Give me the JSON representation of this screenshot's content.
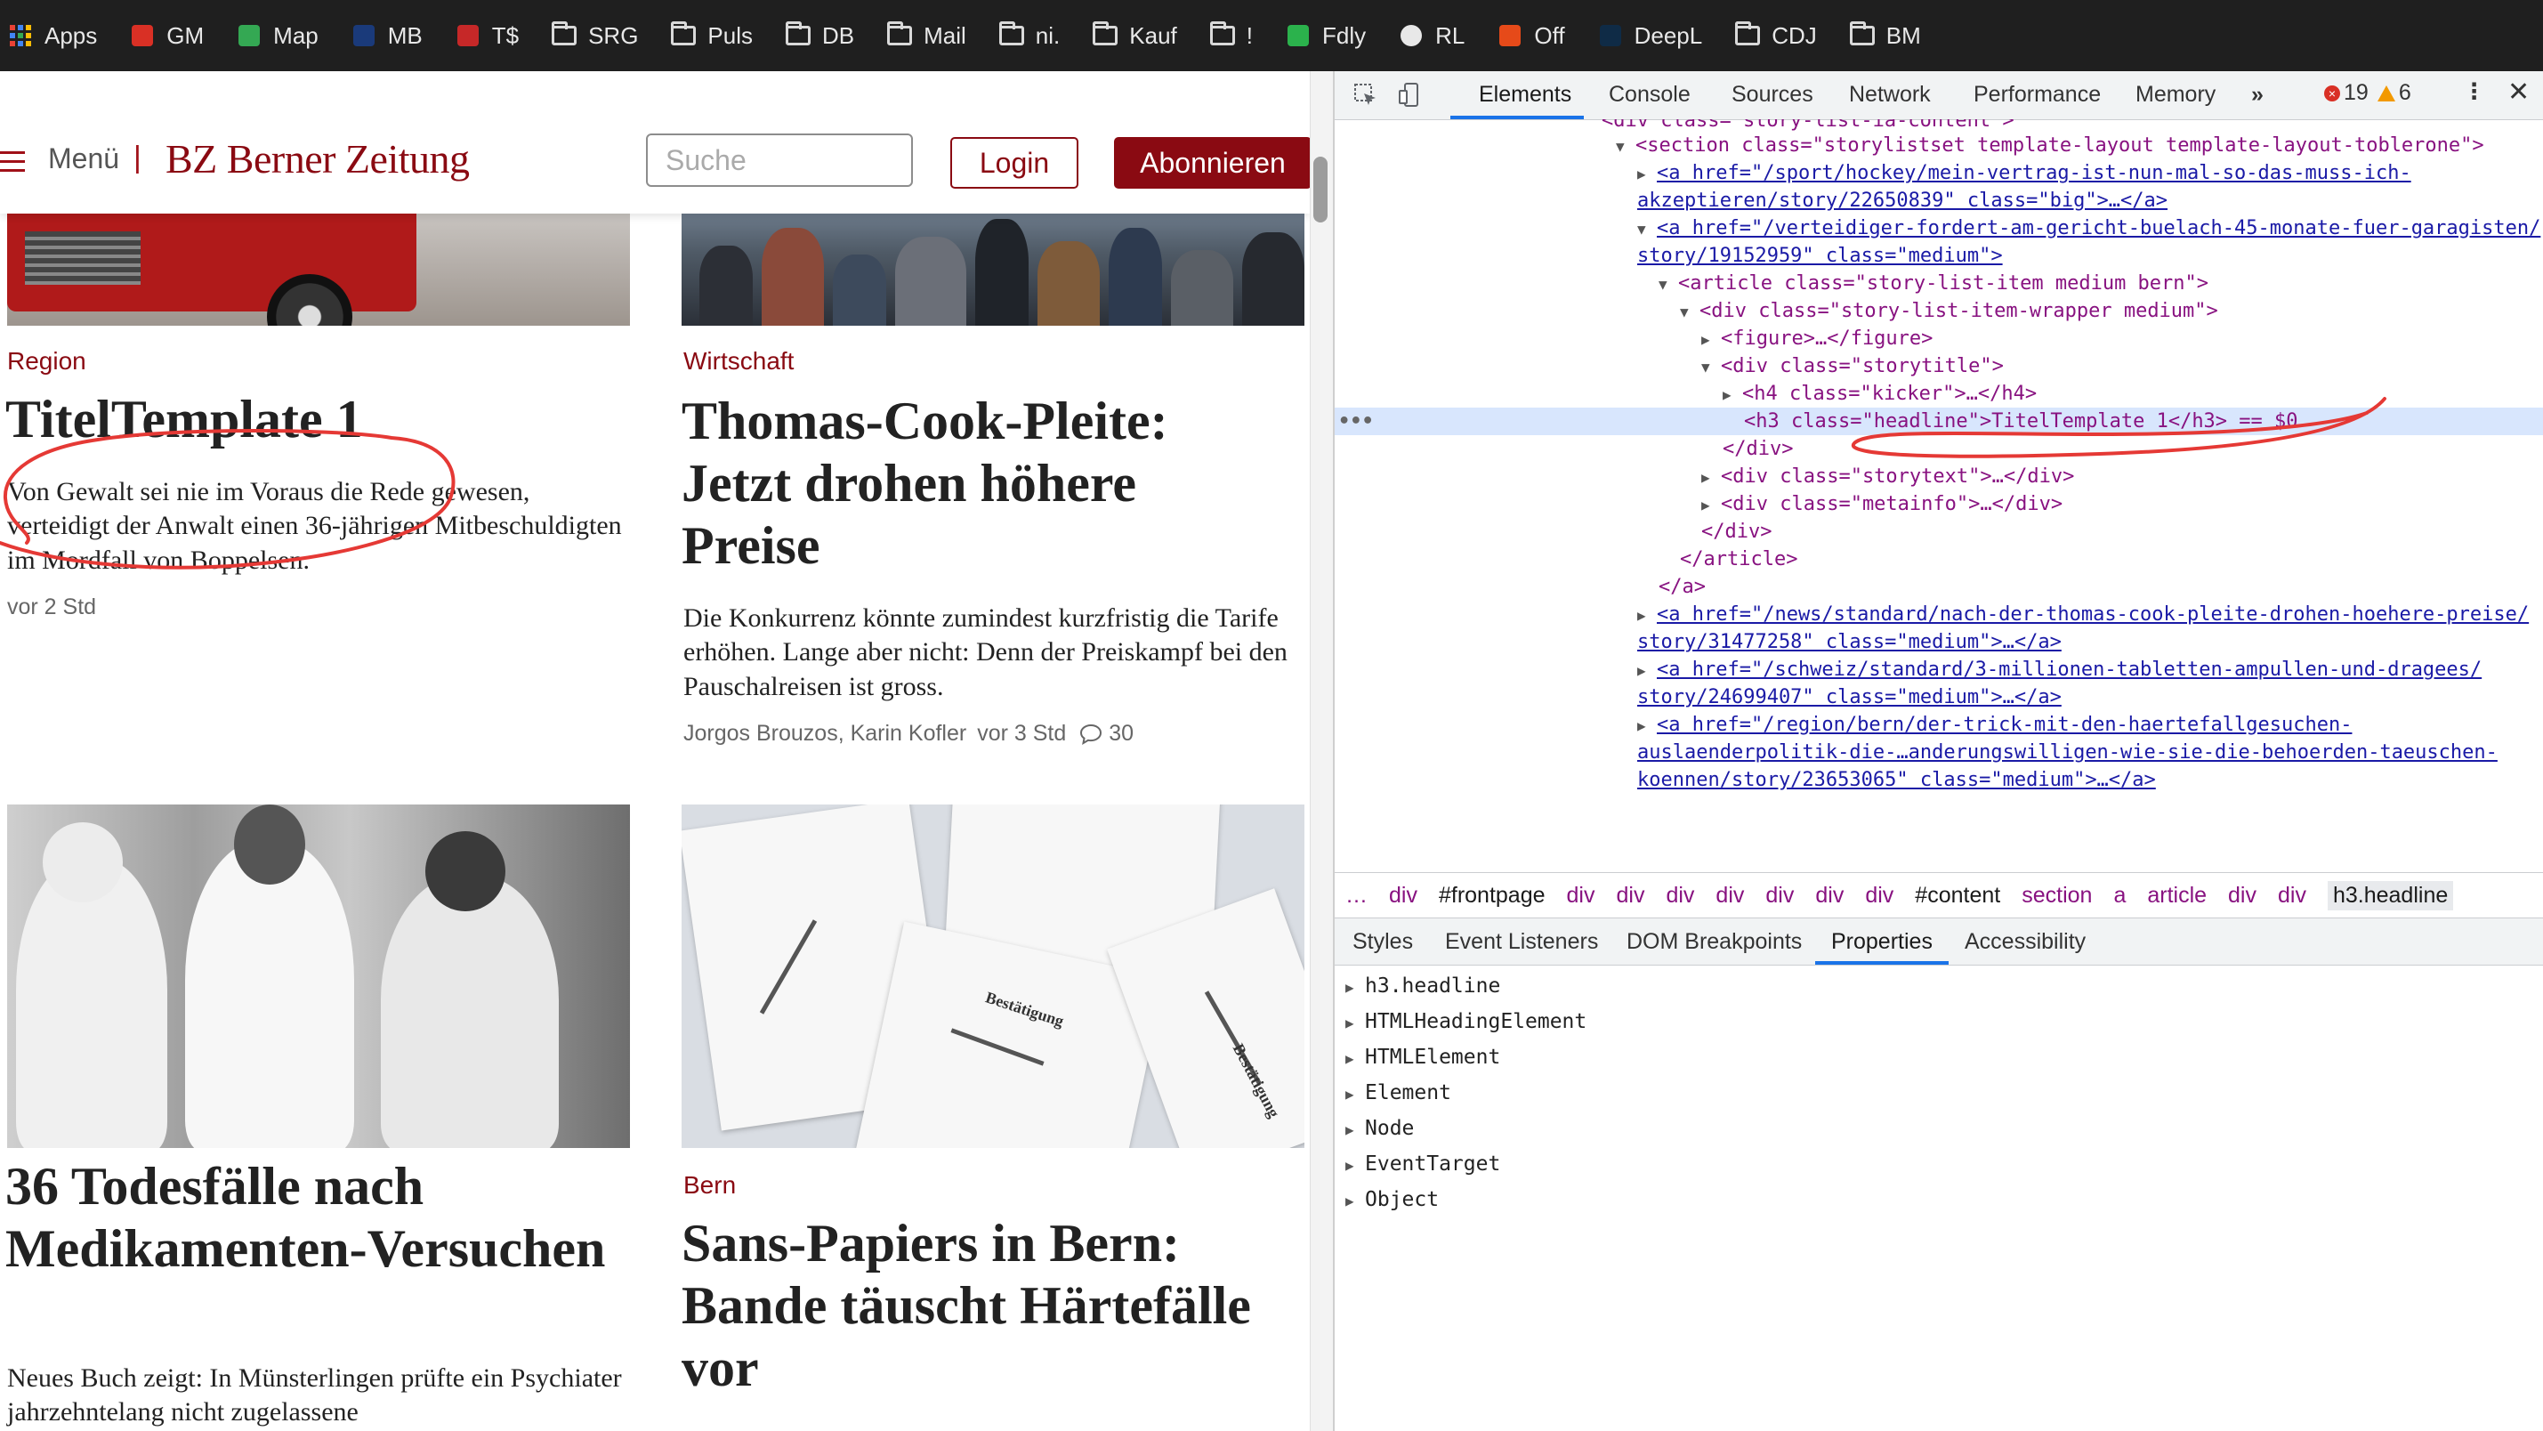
{
  "bookmarks": [
    {
      "label": "Apps",
      "icon": "apps-grid-icon"
    },
    {
      "label": "GM",
      "icon": "gmail-icon"
    },
    {
      "label": "Map",
      "icon": "maps-icon"
    },
    {
      "label": "MB",
      "icon": "mb-icon"
    },
    {
      "label": "T$",
      "icon": "tp-icon"
    },
    {
      "label": "SRG",
      "icon": "folder-icon"
    },
    {
      "label": "Puls",
      "icon": "folder-icon"
    },
    {
      "label": "DB",
      "icon": "folder-icon"
    },
    {
      "label": "Mail",
      "icon": "folder-icon"
    },
    {
      "label": "ni.",
      "icon": "folder-icon"
    },
    {
      "label": "Kauf",
      "icon": "folder-icon"
    },
    {
      "label": "!",
      "icon": "folder-icon"
    },
    {
      "label": "Fdly",
      "icon": "feedly-icon"
    },
    {
      "label": "RL",
      "icon": "globe-icon"
    },
    {
      "label": "Off",
      "icon": "office-icon"
    },
    {
      "label": "DeepL",
      "icon": "deepl-icon"
    },
    {
      "label": "CDJ",
      "icon": "folder-icon"
    },
    {
      "label": "BM",
      "icon": "folder-icon"
    }
  ],
  "site": {
    "menu_label": "Menü",
    "logo_text": "BZ Berner Zeitung",
    "search_placeholder": "Suche",
    "login_label": "Login",
    "subscribe_label": "Abonnieren",
    "brand_color": "#8a0a12"
  },
  "articles": [
    {
      "kicker": "Region",
      "headline": "TitelTemplate 1",
      "lead": "Von Gewalt sei nie im Voraus die Rede gewesen, verteidigt der Anwalt einen 36-jährigen Mitbeschuldigten im Mordfall von Boppelsen.",
      "time": "vor 2 Std"
    },
    {
      "kicker": "Wirtschaft",
      "headline": "Thomas-Cook-Pleite: Jetzt drohen höhere Preise",
      "lead": "Die Konkurrenz könnte zumindest kurzfristig die Tarife erhöhen. Lange aber nicht: Denn der Preiskampf bei den Pauschalreisen ist gross.",
      "authors": "Jorgos Brouzos, Karin Kofler",
      "time": "vor 3 Std",
      "comments": "30"
    },
    {
      "kicker": "",
      "headline": "36 Todesfälle nach Medikamenten-Versuchen",
      "lead": "Neues Buch zeigt: In Münsterlingen prüfte ein Psychiater jahrzehntelang nicht zugelassene"
    },
    {
      "kicker": "Bern",
      "headline": "Sans-Papiers in Bern: Bande täuscht Härtefälle vor",
      "image_text": [
        "Bestätigung",
        "Bestätigung"
      ]
    }
  ],
  "devtools": {
    "tabs": [
      "Elements",
      "Console",
      "Sources",
      "Network",
      "Performance",
      "Memory"
    ],
    "active_tab": "Elements",
    "more_tabs": "»",
    "errors": "19",
    "warnings": "6",
    "dom_lines": [
      {
        "text": "<div class=\"story-list-ia-content\">"
      },
      {
        "text": "<section class=\"storylistset template-layout template-layout-toblerone\">"
      },
      {
        "text": "<a href=\"/sport/hockey/mein-vertrag-ist-nun-mal-so-das-muss-ich-"
      },
      {
        "text": "akzeptieren/story/22650839\" class=\"big\">…</a>"
      },
      {
        "text": "<a href=\"/verteidiger-fordert-am-gericht-buelach-45-monate-fuer-garagisten/"
      },
      {
        "text": "story/19152959\" class=\"medium\">"
      },
      {
        "text": "<article class=\"story-list-item medium bern\">"
      },
      {
        "text": "<div class=\"story-list-item-wrapper medium\">"
      },
      {
        "text": "<figure>…</figure>"
      },
      {
        "text": "<div class=\"storytitle\">"
      },
      {
        "text": "<h4 class=\"kicker\">…</h4>"
      },
      {
        "text": "<h3 class=\"headline\">TitelTemplate 1</h3> == $0"
      },
      {
        "text": "</div>"
      },
      {
        "text": "<div class=\"storytext\">…</div>"
      },
      {
        "text": "<div class=\"metainfo\">…</div>"
      },
      {
        "text": "</div>"
      },
      {
        "text": "</article>"
      },
      {
        "text": "</a>"
      },
      {
        "text": "<a href=\"/news/standard/nach-der-thomas-cook-pleite-drohen-hoehere-preise/"
      },
      {
        "text": "story/31477258\" class=\"medium\">…</a>"
      },
      {
        "text": "<a href=\"/schweiz/standard/3-millionen-tabletten-ampullen-und-dragees/"
      },
      {
        "text": "story/24699407\" class=\"medium\">…</a>"
      },
      {
        "text": "<a href=\"/region/bern/der-trick-mit-den-haertefallgesuchen-"
      },
      {
        "text": "auslaenderpolitik-die-…anderungswilligen-wie-sie-die-behoerden-taeuschen-"
      },
      {
        "text": "koennen/story/23653065\" class=\"medium\">…</a>"
      }
    ],
    "breadcrumbs": [
      "…",
      "div",
      "#frontpage",
      "div",
      "div",
      "div",
      "div",
      "div",
      "div",
      "div",
      "#content",
      "section",
      "a",
      "article",
      "div",
      "div",
      "h3.headline"
    ],
    "subtabs": [
      "Styles",
      "Event Listeners",
      "DOM Breakpoints",
      "Properties",
      "Accessibility"
    ],
    "active_subtab": "Properties",
    "properties": [
      "h3.headline",
      "HTMLHeadingElement",
      "HTMLElement",
      "Element",
      "Node",
      "EventTarget",
      "Object"
    ]
  }
}
